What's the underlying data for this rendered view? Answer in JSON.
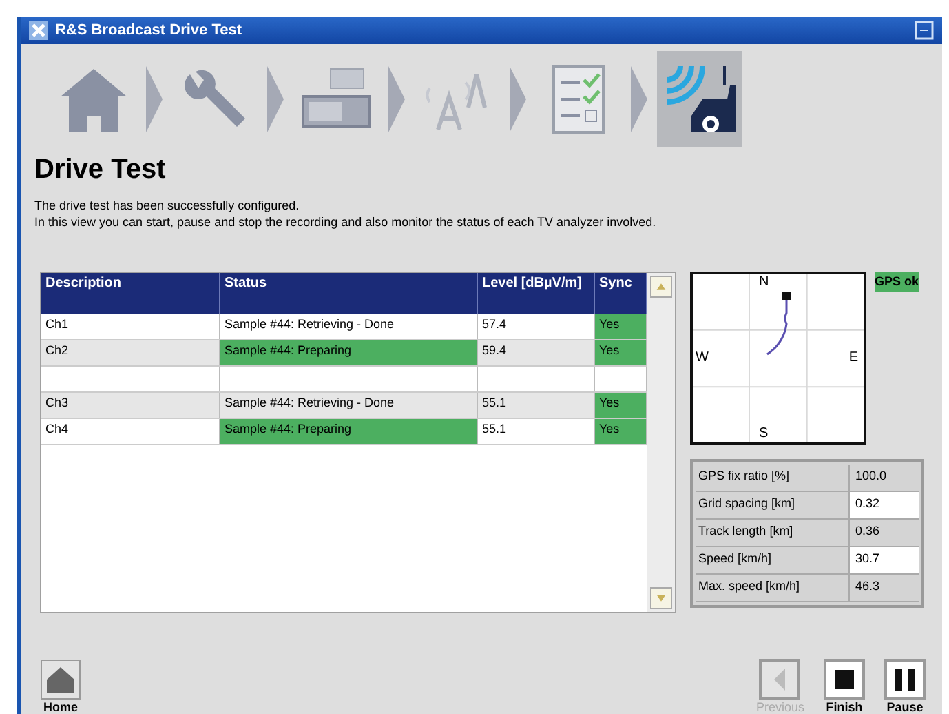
{
  "window": {
    "title": "R&S Broadcast Drive Test"
  },
  "steps": [
    {
      "kind": "home",
      "selected": false
    },
    {
      "kind": "wrench",
      "selected": false
    },
    {
      "kind": "devices",
      "selected": false
    },
    {
      "kind": "antenna",
      "selected": false
    },
    {
      "kind": "checklist",
      "selected": false
    },
    {
      "kind": "car",
      "selected": true
    }
  ],
  "heading": "Drive Test",
  "description": [
    "The drive test has been successfully configured.",
    "In this view you can start, pause and stop the recording and also monitor the status of each TV analyzer involved."
  ],
  "table": {
    "columns": [
      "Description",
      "Status",
      "Level [dBµV/m]",
      "Sync"
    ],
    "rows": [
      {
        "kind": "channel",
        "description": "Ch1",
        "status": "Sample #44: Retrieving - Done",
        "status_active": false,
        "level": "57.4",
        "sync": "Yes"
      },
      {
        "kind": "channel",
        "description": "Ch2",
        "status": "Sample #44: Preparing",
        "status_active": true,
        "level": "59.4",
        "sync": "Yes"
      },
      {
        "kind": "empty"
      },
      {
        "kind": "channel",
        "description": "Ch3",
        "status": "Sample #44: Retrieving - Done",
        "status_active": false,
        "level": "55.1",
        "sync": "Yes"
      },
      {
        "kind": "channel",
        "description": "Ch4",
        "status": "Sample #44: Preparing",
        "status_active": true,
        "level": "55.1",
        "sync": "Yes"
      }
    ]
  },
  "map": {
    "north": "N",
    "east": "E",
    "south": "S",
    "west": "W"
  },
  "gps_status": "GPS ok",
  "stats": [
    {
      "label": "GPS fix ratio [%]",
      "value": "100.0"
    },
    {
      "label": "Grid spacing [km]",
      "value": "0.32"
    },
    {
      "label": "Track length [km]",
      "value": "0.36"
    },
    {
      "label": "Speed [km/h]",
      "value": "30.7"
    },
    {
      "label": "Max. speed [km/h]",
      "value": "46.3"
    }
  ],
  "buttons": [
    {
      "kind": "home",
      "label": "Home",
      "disabled": false
    },
    {
      "kind": "previous",
      "label": "Previous",
      "disabled": true
    },
    {
      "kind": "finish",
      "label": "Finish",
      "disabled": false
    },
    {
      "kind": "pause",
      "label": "Pause",
      "disabled": false
    }
  ]
}
